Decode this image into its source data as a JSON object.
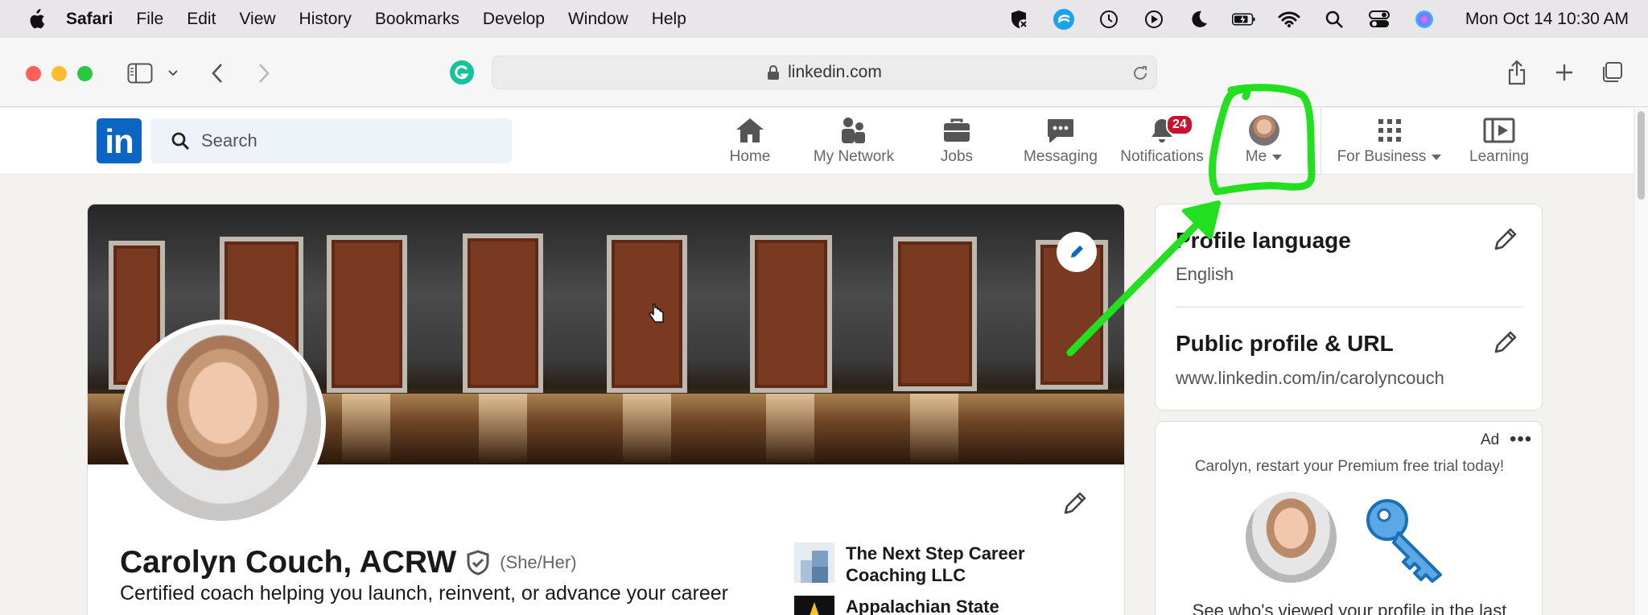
{
  "menubar": {
    "app_name": "Safari",
    "items": [
      "File",
      "Edit",
      "View",
      "History",
      "Bookmarks",
      "Develop",
      "Window",
      "Help"
    ],
    "clock": "Mon Oct 14  10:30 AM"
  },
  "browser": {
    "url": "linkedin.com"
  },
  "linkedin": {
    "search_placeholder": "Search",
    "nav": {
      "home": "Home",
      "network": "My Network",
      "jobs": "Jobs",
      "messaging": "Messaging",
      "notifications": "Notifications",
      "notifications_count": "24",
      "me": "Me",
      "for_business": "For Business",
      "learning": "Learning"
    },
    "profile": {
      "name": "Carolyn Couch, ACRW",
      "pronouns": "(She/Her)",
      "headline": "Certified coach helping you launch, reinvent, or advance your career",
      "experience": [
        {
          "name": "The Next Step Career Coaching LLC"
        },
        {
          "name": "Appalachian State"
        }
      ]
    },
    "rail": {
      "profile_language_title": "Profile language",
      "profile_language_value": "English",
      "public_profile_title": "Public profile & URL",
      "public_profile_value": "www.linkedin.com/in/carolyncouch"
    },
    "ad": {
      "label": "Ad",
      "more": "•••",
      "text": "Carolyn, restart your Premium free trial today!",
      "footer": "See who's viewed your profile in the last"
    }
  },
  "colors": {
    "linkedin_blue": "#0a66c2",
    "notification_red": "#cb112d",
    "annotation_green": "#22e01f"
  }
}
